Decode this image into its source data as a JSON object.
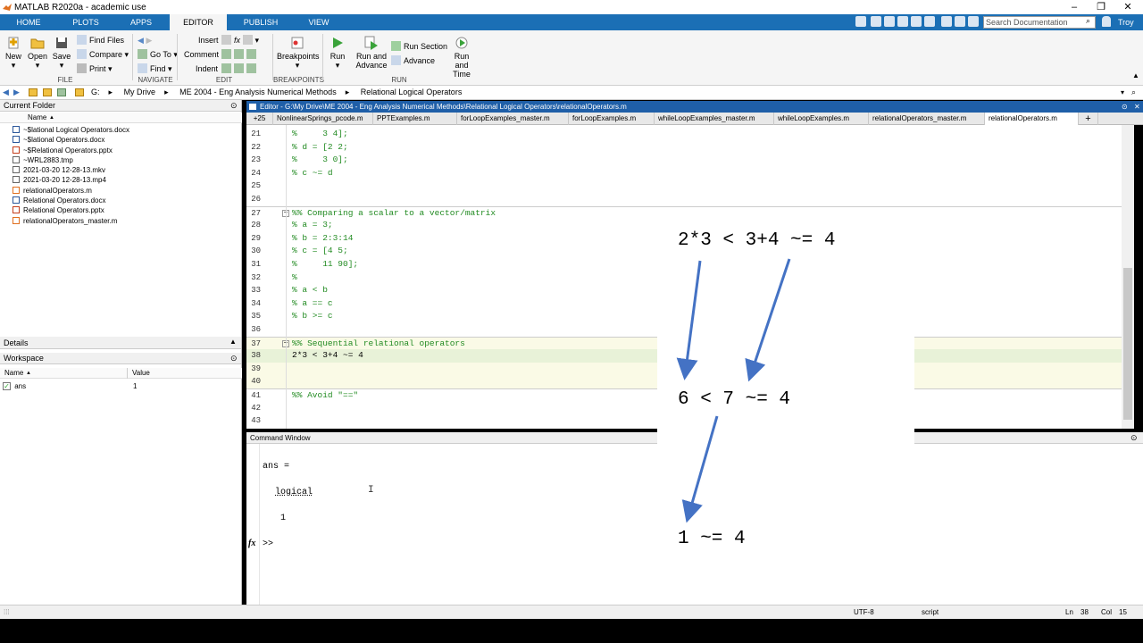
{
  "window": {
    "title": "MATLAB R2020a - academic use"
  },
  "main_tabs": [
    "HOME",
    "PLOTS",
    "APPS",
    "EDITOR",
    "PUBLISH",
    "VIEW"
  ],
  "active_tab": "EDITOR",
  "search_placeholder": "Search Documentation",
  "user": "Troy",
  "ribbon": {
    "file": {
      "new": "New",
      "open": "Open",
      "save": "Save",
      "find_files": "Find Files",
      "compare": "Compare",
      "print": "Print",
      "group": "FILE"
    },
    "navigate": {
      "goto": "Go To",
      "find": "Find",
      "group": "NAVIGATE"
    },
    "edit": {
      "insert": "Insert",
      "comment": "Comment",
      "indent": "Indent",
      "group": "EDIT",
      "fx": "fx"
    },
    "breakpoints": {
      "label": "Breakpoints",
      "group": "BREAKPOINTS"
    },
    "run": {
      "run": "Run",
      "run_advance_1": "Run and",
      "run_advance_2": "Advance",
      "run_section": "Run Section",
      "advance": "Advance",
      "run_time_1": "Run and",
      "run_time_2": "Time",
      "group": "RUN"
    }
  },
  "address": {
    "crumbs": [
      "G:",
      "My Drive",
      "ME 2004 - Eng Analysis Numerical Methods",
      "Relational Logical Operators"
    ]
  },
  "current_folder": {
    "title": "Current Folder",
    "col_name": "Name",
    "sort_glyph": "▲",
    "files": [
      "~$lational Logical Operators.docx",
      "~$lational Operators.docx",
      "~$Relational Operators.pptx",
      "~WRL2883.tmp",
      "2021-03-20 12-28-13.mkv",
      "2021-03-20 12-28-13.mp4",
      "relationalOperators.m",
      "Relational Operators.docx",
      "Relational Operators.pptx",
      "relationalOperators_master.m"
    ]
  },
  "details": {
    "title": "Details"
  },
  "workspace": {
    "title": "Workspace",
    "col_name": "Name",
    "col_value": "Value",
    "sort_glyph": "▲",
    "var_name": "ans",
    "var_value": "1"
  },
  "editor": {
    "title": "Editor - G:\\My Drive\\ME 2004 - Eng Analysis Numerical Methods\\Relational Logical Operators\\relationalOperators.m",
    "tab_count": "+25",
    "add_tab": "+",
    "tabs": [
      "NonlinearSprings_pcode.m",
      "PPTExamples.m",
      "forLoopExamples_master.m",
      "forLoopExamples.m",
      "whileLoopExamples_master.m",
      "whileLoopExamples.m",
      "relationalOperators_master.m",
      "relationalOperators.m"
    ],
    "lines": [
      {
        "n": "21",
        "t": "%     3 4];"
      },
      {
        "n": "22",
        "t": "% d = [2 2;"
      },
      {
        "n": "23",
        "t": "%     3 0];"
      },
      {
        "n": "24",
        "t": "% c ~= d"
      },
      {
        "n": "25",
        "t": ""
      },
      {
        "n": "26",
        "t": ""
      },
      {
        "n": "27",
        "t": "%% Comparing a scalar to a vector/matrix"
      },
      {
        "n": "28",
        "t": "% a = 3;"
      },
      {
        "n": "29",
        "t": "% b = 2:3:14"
      },
      {
        "n": "30",
        "t": "% c = [4 5;"
      },
      {
        "n": "31",
        "t": "%     11 90];"
      },
      {
        "n": "32",
        "t": "%"
      },
      {
        "n": "33",
        "t": "% a < b"
      },
      {
        "n": "34",
        "t": "% a == c"
      },
      {
        "n": "35",
        "t": "% b >= c"
      },
      {
        "n": "36",
        "t": ""
      },
      {
        "n": "37",
        "t": "%% Sequential relational operators"
      },
      {
        "n": "38",
        "t": "2*3 < 3+4 ~= 4"
      },
      {
        "n": "39",
        "t": ""
      },
      {
        "n": "40",
        "t": ""
      },
      {
        "n": "41",
        "t": "%% Avoid \"==\""
      },
      {
        "n": "42",
        "t": ""
      },
      {
        "n": "43",
        "t": ""
      }
    ]
  },
  "command_window": {
    "title": "Command Window",
    "lines": [
      "ans =",
      "logical",
      "1"
    ],
    "prompt": ">>",
    "fx": "fx"
  },
  "overlay": {
    "step1": "2*3 < 3+4 ~= 4",
    "step2": "6 < 7 ~= 4",
    "step3": "1 ~= 4",
    "arrow_color": "#4472c4"
  },
  "status": {
    "encoding": "UTF-8",
    "type": "script",
    "ln_label": "Ln",
    "ln": "38",
    "col_label": "Col",
    "col": "15"
  },
  "colors": {
    "accent": "#1b6fb5",
    "comment": "#228b22"
  }
}
